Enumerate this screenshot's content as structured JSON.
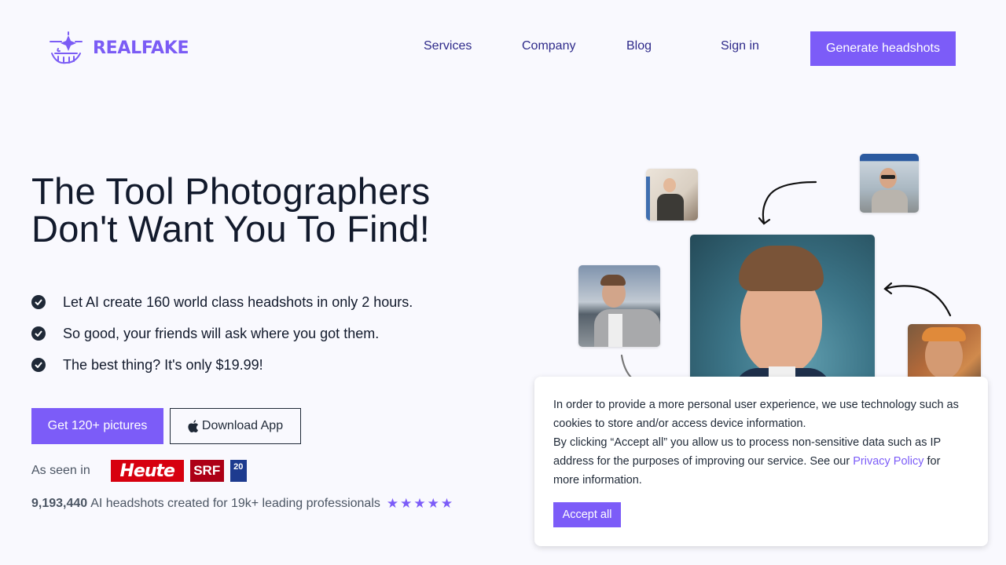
{
  "brand": {
    "name": "REALFAKE",
    "accent": "#7c5cf8"
  },
  "nav": {
    "items": [
      "Services",
      "Company",
      "Blog"
    ],
    "sign_in": "Sign in",
    "cta": "Generate headshots"
  },
  "hero": {
    "title_line1": "The Tool Photographers",
    "title_line2": "Don't Want You To Find!",
    "features": [
      "Let AI create 160 world class headshots in only 2 hours.",
      "So good, your friends will ask where you got them.",
      "The best thing? It's only $19.99!"
    ],
    "primary_button": "Get 120+ pictures",
    "secondary_button": "Download App",
    "seen_in_label": "As seen in",
    "press": [
      "Heute",
      "SRF",
      "20"
    ],
    "stats_count": "9,193,440",
    "stats_text": "AI headshots created for 19k+ leading professionals",
    "rating_stars": 5
  },
  "gallery": {
    "photos": [
      "selfie-mirror",
      "selfie-sunglasses",
      "selfie-outdoor",
      "ai-headshot-main",
      "selfie-party"
    ]
  },
  "cookie_banner": {
    "text1": "In order to provide a more personal user experience, we use technology such as cookies to store and/or access device information.",
    "text2_before": "By clicking “Accept all” you allow us to process non-sensitive data such as IP address for the purposes of improving our service. See our ",
    "privacy_link": "Privacy Policy",
    "text2_after": " for more information.",
    "accept_button": "Accept all"
  }
}
